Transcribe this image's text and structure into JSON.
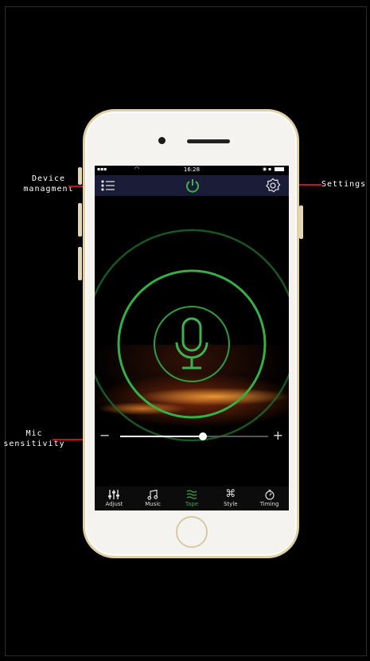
{
  "status_bar": {
    "time": "16:28"
  },
  "annotations": {
    "device_management": "Device managment",
    "settings": "Settings",
    "mic_sensitivity": "Mic sensitivity"
  },
  "mic_sensitivity": {
    "value_fraction": 0.56,
    "minus": "−",
    "plus": "+"
  },
  "tabs": [
    {
      "label": "Adjust",
      "icon": "sliders-icon"
    },
    {
      "label": "Music",
      "icon": "music-note-icon"
    },
    {
      "label": "Tape",
      "icon": "tape-wave-icon",
      "active": true
    },
    {
      "label": "Style",
      "icon": "command-icon"
    },
    {
      "label": "Timing",
      "icon": "timer-icon"
    }
  ],
  "colors": {
    "accent_green": "#3da14a",
    "nav_bar": "#1a1c38",
    "callout_red": "#c5121a",
    "phone_frame": "#e2cfa6"
  }
}
